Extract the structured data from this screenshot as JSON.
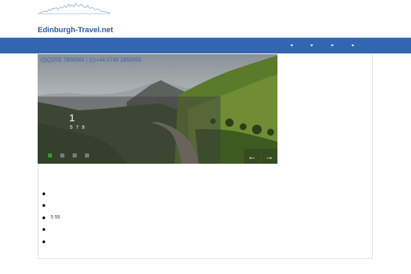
{
  "header": {
    "site_title": "Edinburgh-Travel.net"
  },
  "colors": {
    "navbar": "#3366b0",
    "title": "#2a5a9e",
    "active_dot": "#26a326"
  },
  "navbar": {
    "menus": [
      {
        "icon": "caret-down-icon"
      },
      {
        "icon": "caret-down-icon"
      },
      {
        "icon": "caret-down-icon"
      },
      {
        "icon": "caret-down-icon"
      }
    ]
  },
  "slider": {
    "contact": {
      "qq_text": "QQ)205 7806565",
      "separator": " | ",
      "phone_text": "+44 0746 2659955"
    },
    "caption": {
      "number": "1",
      "subtitle": "5 7 9"
    },
    "prev_label": "←",
    "next_label": "→",
    "dots_total": 4,
    "active_dot_index": 0
  },
  "list": {
    "items": [
      "",
      "",
      "5 55",
      "",
      ""
    ]
  }
}
